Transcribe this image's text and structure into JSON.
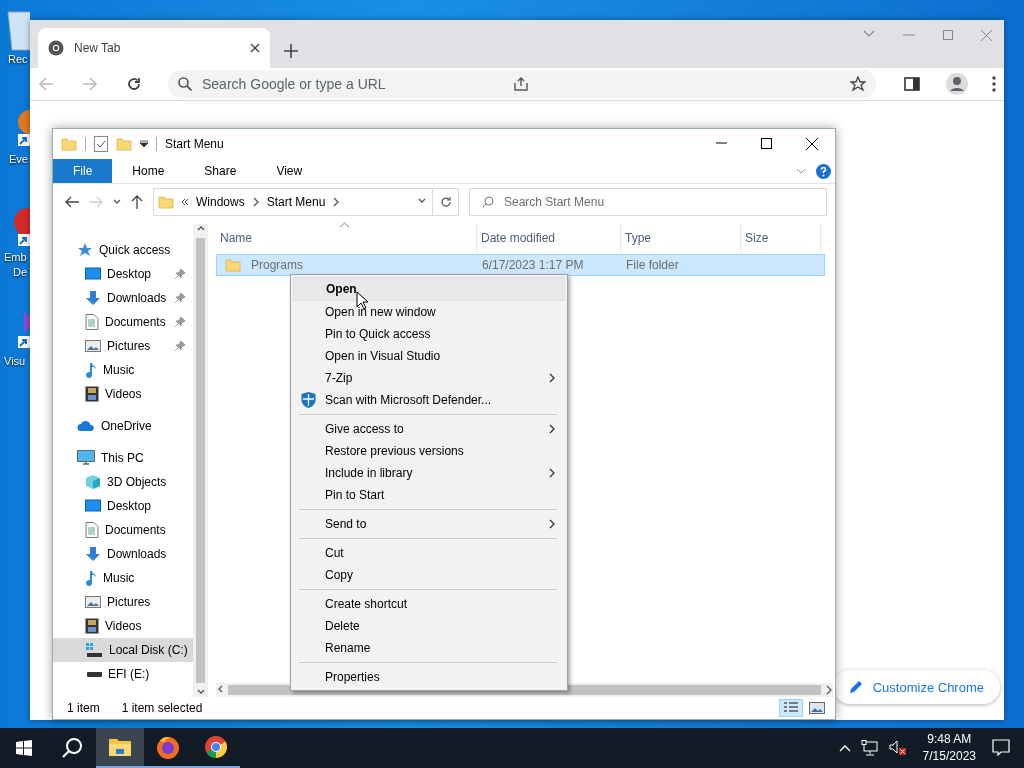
{
  "desktop_icons": [
    {
      "lines": [
        "Rec"
      ],
      "kind": "recycle-bin"
    },
    {
      "lines": [
        "Eve"
      ],
      "kind": "shortcut-orange"
    },
    {
      "lines": [
        "Emb",
        "De"
      ],
      "kind": "shortcut-red"
    },
    {
      "lines": [
        "Visu"
      ],
      "kind": "shortcut-purple"
    }
  ],
  "browser": {
    "tab": {
      "title": "New Tab"
    },
    "omnibox": {
      "placeholder": "Search Google or type a URL"
    },
    "customize_button": "Customize Chrome"
  },
  "explorer": {
    "title": "Start Menu",
    "ribbon_tabs": [
      {
        "label": "File",
        "selected": true
      },
      {
        "label": "Home",
        "selected": false
      },
      {
        "label": "Share",
        "selected": false
      },
      {
        "label": "View",
        "selected": false
      }
    ],
    "breadcrumb": [
      "Windows",
      "Start Menu"
    ],
    "search": {
      "placeholder": "Search Start Menu"
    },
    "navigation": [
      {
        "label": "Quick access",
        "kind": "star",
        "selected": false,
        "children": [
          {
            "label": "Desktop",
            "kind": "desktop",
            "pinned": true,
            "selected": false
          },
          {
            "label": "Downloads",
            "kind": "downloads",
            "pinned": true,
            "selected": false
          },
          {
            "label": "Documents",
            "kind": "documents",
            "pinned": true,
            "selected": false
          },
          {
            "label": "Pictures",
            "kind": "pictures",
            "pinned": true,
            "selected": false
          },
          {
            "label": "Music",
            "kind": "music",
            "pinned": false,
            "selected": false
          },
          {
            "label": "Videos",
            "kind": "videos",
            "pinned": false,
            "selected": false
          }
        ]
      },
      {
        "label": "OneDrive",
        "kind": "cloud",
        "selected": false
      },
      {
        "label": "This PC",
        "kind": "computer",
        "selected": false,
        "children": [
          {
            "label": "3D Objects",
            "kind": "cube",
            "pinned": false,
            "selected": false
          },
          {
            "label": "Desktop",
            "kind": "desktop",
            "pinned": false,
            "selected": false
          },
          {
            "label": "Documents",
            "kind": "documents",
            "pinned": false,
            "selected": false
          },
          {
            "label": "Downloads",
            "kind": "downloads",
            "pinned": false,
            "selected": false
          },
          {
            "label": "Music",
            "kind": "music",
            "pinned": false,
            "selected": false
          },
          {
            "label": "Pictures",
            "kind": "pictures",
            "pinned": false,
            "selected": false
          },
          {
            "label": "Videos",
            "kind": "videos",
            "pinned": false,
            "selected": false
          },
          {
            "label": "Local Disk (C:)",
            "kind": "system-drive",
            "pinned": false,
            "selected": true
          },
          {
            "label": "EFI (E:)",
            "kind": "drive",
            "pinned": false,
            "selected": false
          }
        ]
      }
    ],
    "columns": [
      "Name",
      "Date modified",
      "Type",
      "Size"
    ],
    "rows": [
      {
        "name": "Programs",
        "date_modified": "6/17/2023 1:17 PM",
        "type": "File folder",
        "selected": true
      }
    ],
    "status": {
      "item_count": "1 item",
      "selection": "1 item selected"
    },
    "views": [
      {
        "kind": "details",
        "selected": true
      },
      {
        "kind": "large-icons",
        "selected": false
      }
    ]
  },
  "context_menu": [
    {
      "kind": "command",
      "label": "Open",
      "default": true,
      "selected": true,
      "submenu": false
    },
    {
      "kind": "command",
      "label": "Open in new window",
      "default": false,
      "selected": false,
      "submenu": false
    },
    {
      "kind": "command",
      "label": "Pin to Quick access",
      "default": false,
      "selected": false,
      "submenu": false
    },
    {
      "kind": "command",
      "label": "Open in Visual Studio",
      "default": false,
      "selected": false,
      "submenu": false
    },
    {
      "kind": "command",
      "label": "7-Zip",
      "default": false,
      "selected": false,
      "submenu": true
    },
    {
      "kind": "shield-command",
      "label": "Scan with Microsoft Defender...",
      "default": false,
      "selected": false,
      "submenu": false
    },
    {
      "kind": "separator"
    },
    {
      "kind": "command",
      "label": "Give access to",
      "default": false,
      "selected": false,
      "submenu": true
    },
    {
      "kind": "command",
      "label": "Restore previous versions",
      "default": false,
      "selected": false,
      "submenu": false
    },
    {
      "kind": "command",
      "label": "Include in library",
      "default": false,
      "selected": false,
      "submenu": true
    },
    {
      "kind": "command",
      "label": "Pin to Start",
      "default": false,
      "selected": false,
      "submenu": false
    },
    {
      "kind": "separator"
    },
    {
      "kind": "command",
      "label": "Send to",
      "default": false,
      "selected": false,
      "submenu": true
    },
    {
      "kind": "separator"
    },
    {
      "kind": "command",
      "label": "Cut",
      "default": false,
      "selected": false,
      "submenu": false
    },
    {
      "kind": "command",
      "label": "Copy",
      "default": false,
      "selected": false,
      "submenu": false
    },
    {
      "kind": "separator"
    },
    {
      "kind": "command",
      "label": "Create shortcut",
      "default": false,
      "selected": false,
      "submenu": false
    },
    {
      "kind": "command",
      "label": "Delete",
      "default": false,
      "selected": false,
      "submenu": false
    },
    {
      "kind": "command",
      "label": "Rename",
      "default": false,
      "selected": false,
      "submenu": false
    },
    {
      "kind": "separator"
    },
    {
      "kind": "command",
      "label": "Properties",
      "default": false,
      "selected": false,
      "submenu": false
    }
  ],
  "taskbar": {
    "apps": [
      {
        "kind": "file-explorer",
        "active": true
      },
      {
        "kind": "firefox",
        "active": false
      },
      {
        "kind": "chrome",
        "active": false
      }
    ],
    "time": "9:48 AM",
    "date": "7/15/2023"
  }
}
